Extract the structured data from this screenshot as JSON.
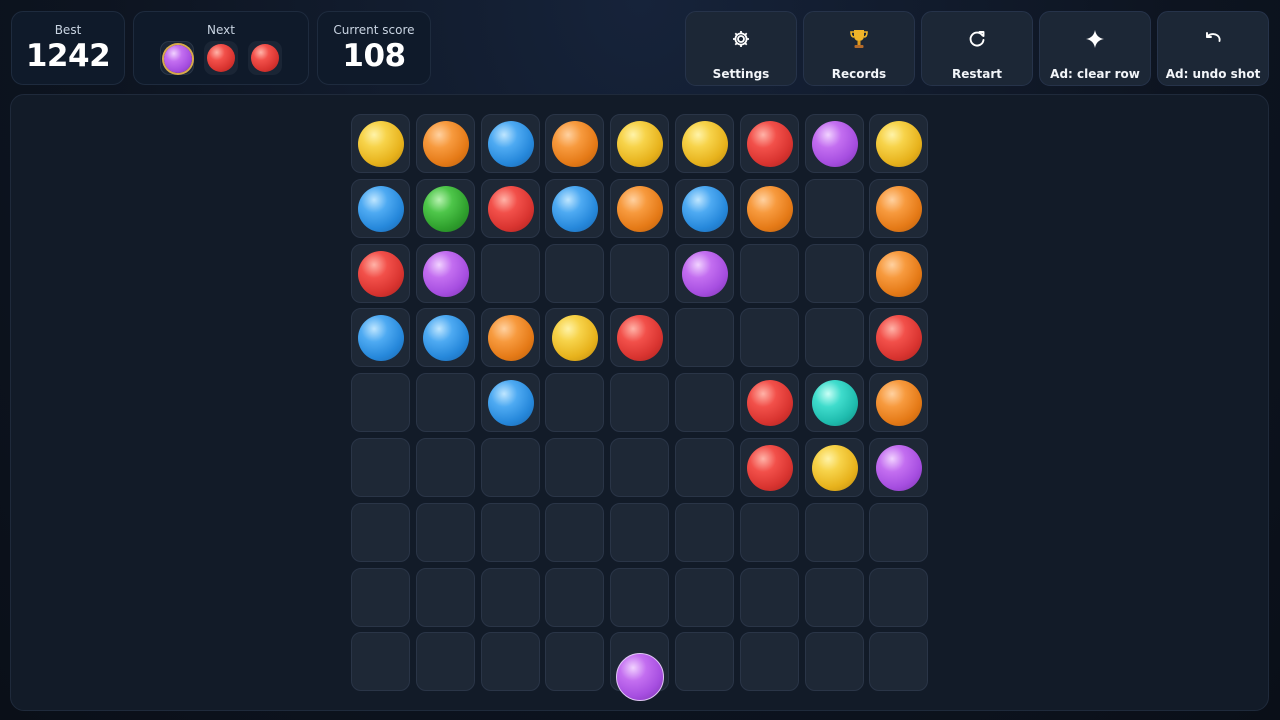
{
  "stats": {
    "best_label": "Best",
    "best_value": "1242",
    "next_label": "Next",
    "score_label": "Current score",
    "score_value": "108"
  },
  "next_balls": [
    "purple",
    "red",
    "red"
  ],
  "next_selected_index": 0,
  "actions": [
    {
      "id": "settings",
      "label": "Settings",
      "icon": "gear-icon"
    },
    {
      "id": "records",
      "label": "Records",
      "icon": "trophy-icon"
    },
    {
      "id": "restart",
      "label": "Restart",
      "icon": "restart-icon"
    },
    {
      "id": "clear-row",
      "label": "Ad: clear row",
      "icon": "sparkle-icon"
    },
    {
      "id": "undo-shot",
      "label": "Ad: undo shot",
      "icon": "undo-icon"
    }
  ],
  "board": {
    "columns": 9,
    "rows": 9,
    "cells": [
      [
        "yellow",
        "orange",
        "blue",
        "orange",
        "yellow",
        "yellow",
        "red",
        "purple",
        "yellow"
      ],
      [
        "blue",
        "green",
        "red",
        "blue",
        "orange",
        "blue",
        "orange",
        null,
        "orange"
      ],
      [
        "red",
        "purple",
        null,
        null,
        null,
        "purple",
        null,
        null,
        "orange"
      ],
      [
        "blue",
        "blue",
        "orange",
        "yellow",
        "red",
        null,
        null,
        null,
        "red"
      ],
      [
        null,
        null,
        "blue",
        null,
        null,
        null,
        "red",
        "teal",
        "orange"
      ],
      [
        null,
        null,
        null,
        null,
        null,
        null,
        "red",
        "yellow",
        "purple"
      ],
      [
        null,
        null,
        null,
        null,
        null,
        null,
        null,
        null,
        null
      ],
      [
        null,
        null,
        null,
        null,
        null,
        null,
        null,
        null,
        null
      ],
      [
        null,
        null,
        null,
        null,
        null,
        null,
        null,
        null,
        null
      ]
    ]
  },
  "shooter": {
    "color": "purple",
    "column": 4
  },
  "colors": {
    "accent_selected": "#d8a94a",
    "panel_bg": "#0f1a2a",
    "cell_bg": "#1e2836"
  }
}
